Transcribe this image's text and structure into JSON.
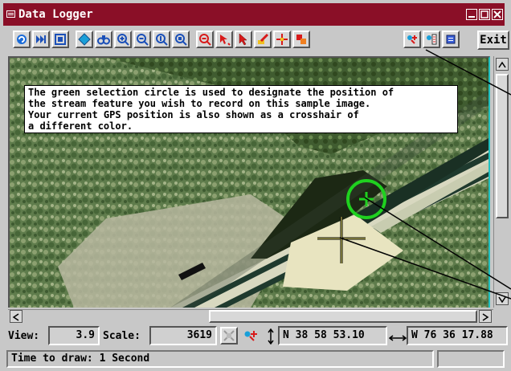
{
  "window": {
    "title": "Data Logger"
  },
  "toolbar": {
    "exit_label": "Exit",
    "tools": [
      "redraw-icon",
      "skip-icon",
      "full-view-icon",
      "diamond-icon",
      "binoculars-icon",
      "zoom-in-icon",
      "zoom-out-icon",
      "zoom-1x-icon",
      "zoom-box-icon",
      "zoom-tool-icon",
      "move-select-icon",
      "arrow-select-icon",
      "edit-tool-icon",
      "gps-crosshair-icon",
      "layer-icon",
      "gps-log-icon",
      "gps-settings-icon",
      "window-icon"
    ]
  },
  "note": {
    "text": "The green selection circle is used to designate the position of\nthe stream feature you wish to record on this sample image.\nYour current GPS position is also shown as a crosshair of\na different color."
  },
  "status": {
    "view_label": "View:",
    "view_value": "3.9",
    "scale_label": "Scale:",
    "scale_value": "3619",
    "latitude": "N 38 58 53.10",
    "longitude": "W 76 36 17.88",
    "message": "Time to draw: 1 Second"
  },
  "colors": {
    "titlebar": "#8a0f27",
    "selection_circle": "#1fd11f",
    "gps_crosshair": "#e8e070"
  }
}
